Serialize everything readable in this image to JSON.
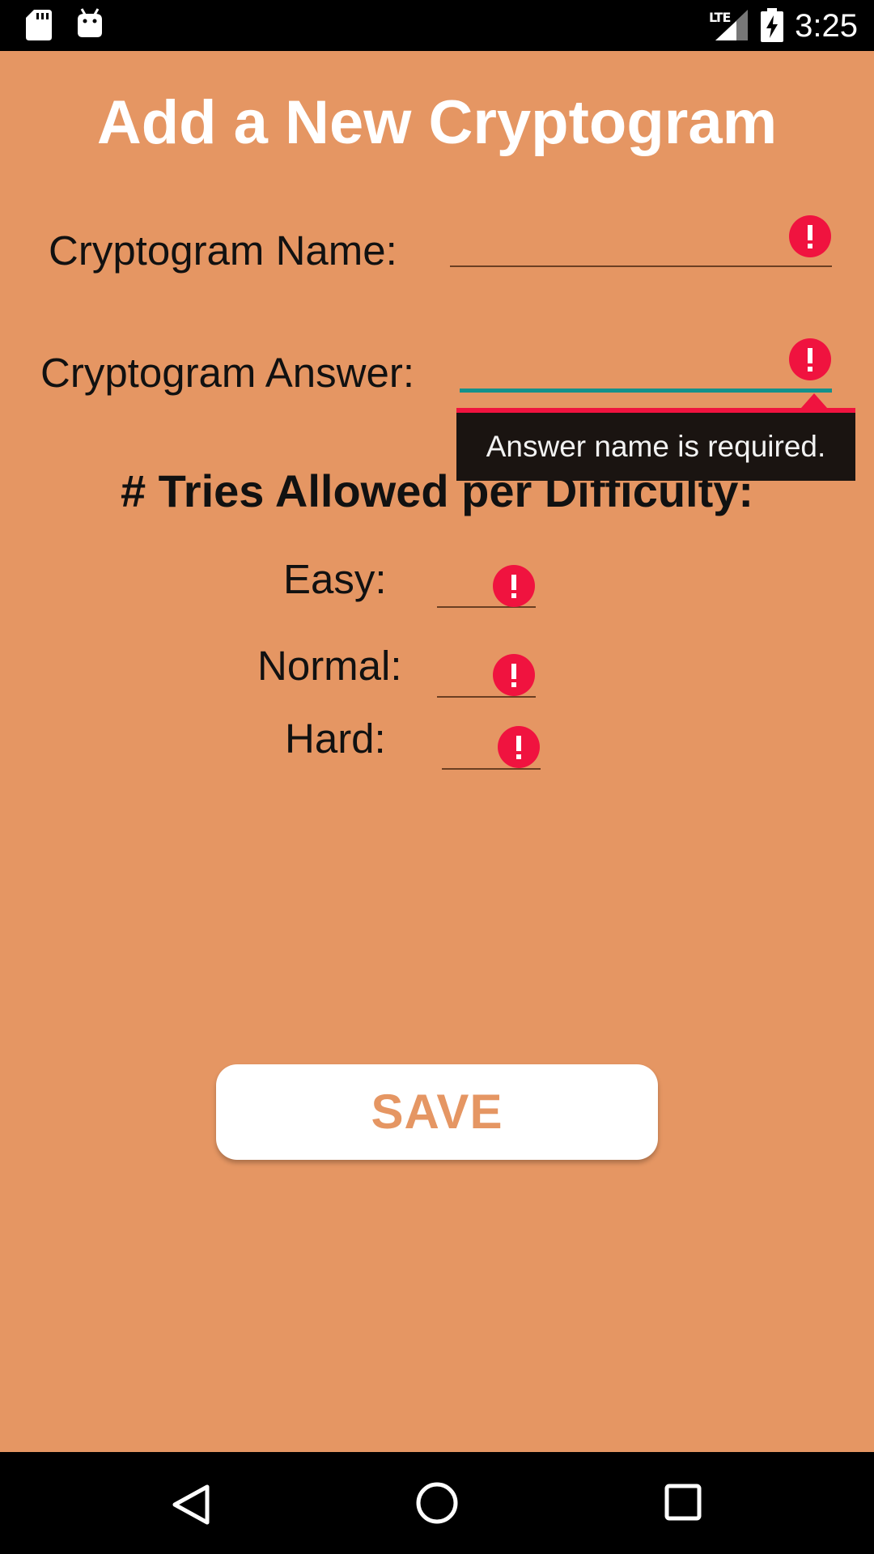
{
  "status_bar": {
    "time": "3:25",
    "network": "LTE",
    "icons": [
      "sd-card-icon",
      "android-debug-icon",
      "signal-icon",
      "battery-charging-icon"
    ]
  },
  "form": {
    "title": "Add a New Cryptogram",
    "name_label": "Cryptogram Name:",
    "name_value": "",
    "answer_label": "Cryptogram Answer:",
    "answer_value": "",
    "answer_error": "Answer name is required.",
    "tries_heading": "# Tries Allowed per Difficulty:",
    "easy_label": "Easy:",
    "easy_value": "",
    "normal_label": "Normal:",
    "normal_value": "",
    "hard_label": "Hard:",
    "hard_value": "",
    "save_label": "SAVE"
  },
  "nav_bar": {
    "icons": [
      "back-icon",
      "home-icon",
      "recents-icon"
    ]
  },
  "colors": {
    "background": "#e59663",
    "error": "#f0133f",
    "focus_accent": "#14918b",
    "button_text": "#e59663"
  }
}
